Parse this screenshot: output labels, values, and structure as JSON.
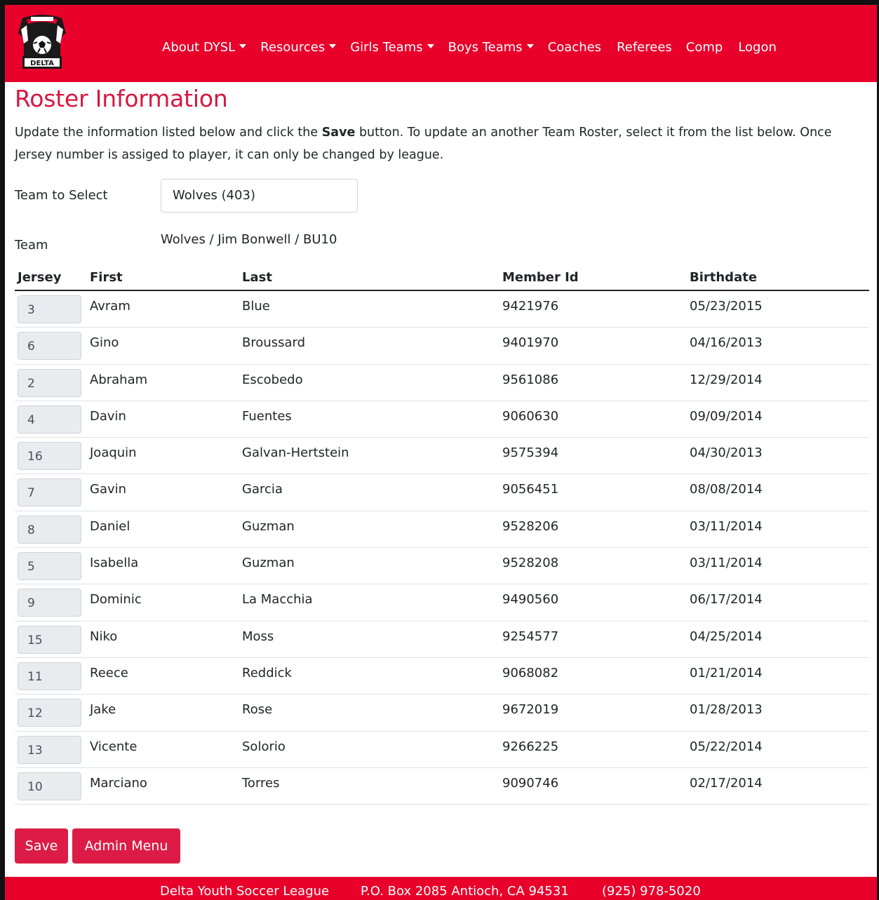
{
  "nav": {
    "logo_text": "DELTA",
    "items": [
      {
        "label": "About DYSL",
        "dropdown": true
      },
      {
        "label": "Resources",
        "dropdown": true
      },
      {
        "label": "Girls Teams",
        "dropdown": true
      },
      {
        "label": "Boys Teams",
        "dropdown": true
      },
      {
        "label": "Coaches",
        "dropdown": false
      },
      {
        "label": "Referees",
        "dropdown": false
      },
      {
        "label": "Comp",
        "dropdown": false
      },
      {
        "label": "Logon",
        "dropdown": false
      }
    ]
  },
  "page": {
    "title": "Roster Information",
    "intro_before": "Update the information listed below and click the ",
    "intro_bold": "Save",
    "intro_after": " button. To update an another Team Roster, select it from the list below. Once Jersey number is assiged to player, it can only be changed by league."
  },
  "form": {
    "team_select_label": "Team to Select",
    "team_select_value": "Wolves (403)",
    "team_label": "Team",
    "team_value": "Wolves / Jim Bonwell / BU10"
  },
  "table": {
    "headers": {
      "jersey": "Jersey",
      "first": "First",
      "last": "Last",
      "member_id": "Member Id",
      "birthdate": "Birthdate"
    },
    "rows": [
      {
        "jersey": "3",
        "first": "Avram",
        "last": "Blue",
        "member_id": "9421976",
        "birthdate": "05/23/2015"
      },
      {
        "jersey": "6",
        "first": "Gino",
        "last": "Broussard",
        "member_id": "9401970",
        "birthdate": "04/16/2013"
      },
      {
        "jersey": "2",
        "first": "Abraham",
        "last": "Escobedo",
        "member_id": "9561086",
        "birthdate": "12/29/2014"
      },
      {
        "jersey": "4",
        "first": "Davin",
        "last": "Fuentes",
        "member_id": "9060630",
        "birthdate": "09/09/2014"
      },
      {
        "jersey": "16",
        "first": "Joaquin",
        "last": "Galvan-Hertstein",
        "member_id": "9575394",
        "birthdate": "04/30/2013"
      },
      {
        "jersey": "7",
        "first": "Gavin",
        "last": "Garcia",
        "member_id": "9056451",
        "birthdate": "08/08/2014"
      },
      {
        "jersey": "8",
        "first": "Daniel",
        "last": "Guzman",
        "member_id": "9528206",
        "birthdate": "03/11/2014"
      },
      {
        "jersey": "5",
        "first": "Isabella",
        "last": "Guzman",
        "member_id": "9528208",
        "birthdate": "03/11/2014"
      },
      {
        "jersey": "9",
        "first": "Dominic",
        "last": "La Macchia",
        "member_id": "9490560",
        "birthdate": "06/17/2014"
      },
      {
        "jersey": "15",
        "first": "Niko",
        "last": "Moss",
        "member_id": "9254577",
        "birthdate": "04/25/2014"
      },
      {
        "jersey": "11",
        "first": "Reece",
        "last": "Reddick",
        "member_id": "9068082",
        "birthdate": "01/21/2014"
      },
      {
        "jersey": "12",
        "first": "Jake",
        "last": "Rose",
        "member_id": "9672019",
        "birthdate": "01/28/2013"
      },
      {
        "jersey": "13",
        "first": "Vicente",
        "last": "Solorio",
        "member_id": "9266225",
        "birthdate": "05/22/2014"
      },
      {
        "jersey": "10",
        "first": "Marciano",
        "last": "Torres",
        "member_id": "9090746",
        "birthdate": "02/17/2014"
      }
    ]
  },
  "buttons": {
    "save": "Save",
    "admin_menu": "Admin Menu"
  },
  "footer": {
    "org": "Delta Youth Soccer League",
    "address": "P.O. Box 2085 Antioch, CA 94531",
    "phone": "(925) 978-5020"
  },
  "colors": {
    "brand_red": "#e8002b",
    "title_red": "#d9163f",
    "button_red": "#dc1c47"
  }
}
